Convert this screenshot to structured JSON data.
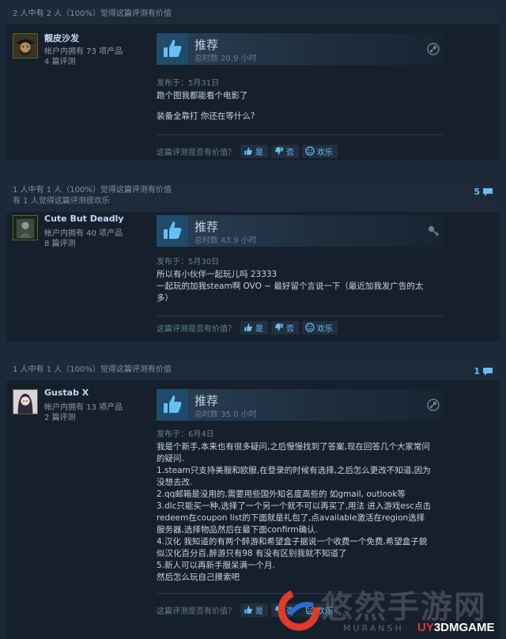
{
  "colors": {
    "accent": "#66c0f4",
    "background": "#1b2838",
    "card": "#16202d"
  },
  "reviews": [
    {
      "helpful_line": "2 人中有 2 人（100%）觉得这篇评测有价值",
      "funny_line": "",
      "comment_count": "",
      "author": {
        "name": "靓皮沙发",
        "products": "帐户内拥有 73 项产品",
        "reviews": "4 篇评测",
        "avatar": "pirate-avatar"
      },
      "recommendation": "推荐",
      "hours": "总时数 20.9 小时",
      "platform_icon": "steam-icon",
      "posted": "发布于：5月31日",
      "body": [
        "跑个图我都能看个电影了",
        "",
        "装备全靠打 你还在等什么?"
      ],
      "helpful_question": "这篇评测是否有价值？",
      "yes": "是",
      "no": "否",
      "funny": "欢乐"
    },
    {
      "helpful_line": "1 人中有 1 人（100%）觉得这篇评测有价值",
      "funny_line": "有 1 人觉得这篇评测很欢乐",
      "comment_count": "5",
      "author": {
        "name": "Cute But Deadly",
        "products": "帐户内拥有 40 项产品",
        "reviews": "8 篇评测",
        "avatar": "dark-avatar"
      },
      "recommendation": "推荐",
      "hours": "总时数 43.9 小时",
      "platform_icon": "key-icon",
      "posted": "发布于：5月30日",
      "body": [
        "所以有小伙伴一起玩儿吗 23333",
        "一起玩的加我steam啊 OVO ~ 最好留个言说一下（最近加我发广告的太多）"
      ],
      "helpful_question": "这篇评测是否有价值？",
      "yes": "是",
      "no": "否",
      "funny": "欢乐"
    },
    {
      "helpful_line": "1 人中有 1 人（100%）觉得这篇评测有价值",
      "funny_line": "",
      "comment_count": "1",
      "author": {
        "name": "Gustab X",
        "products": "帐户内拥有 13 项产品",
        "reviews": "2 篇评测",
        "avatar": "anime-avatar"
      },
      "recommendation": "推荐",
      "hours": "总时数 35.0 小时",
      "platform_icon": "steam-icon",
      "posted": "发布于：6月4日",
      "body": [
        "我是个新手,本来也有很多疑问,之后慢慢找到了答案,现在回答几个大家常问的疑问.",
        "1.steam只支持美服和欧服,在登录的时候有选择,之后怎么更改不知道,因为没想去改.",
        "2.qq邮箱是没用的,需要用些国外知名度高些的 如gmail, outlook等",
        "3.dlc只能买一种,选择了一个另一个就不可以再买了,用法 进入游戏esc点击redeem在coupon list的下面就是礼包了,点available激活在region选择服务器,选择物品然后在最下面confirm确认.",
        "4.汉化 我知道的有两个醉游和希望盒子据说一个收费一个免费,希望盒子貌似汉化百分百,醉游只有98 有没有区别我就不知道了",
        "5.新人可以再新手服呆满一个月.",
        "然后怎么玩自己摸索吧"
      ],
      "helpful_question": "这篇评测是否有价值？",
      "yes": "是",
      "no": "否",
      "funny": "欢乐"
    }
  ],
  "watermark": {
    "text": "悠然手游网",
    "sub": "MURANSH",
    "logo_y": "UY",
    "logo": "3DMGAME"
  }
}
